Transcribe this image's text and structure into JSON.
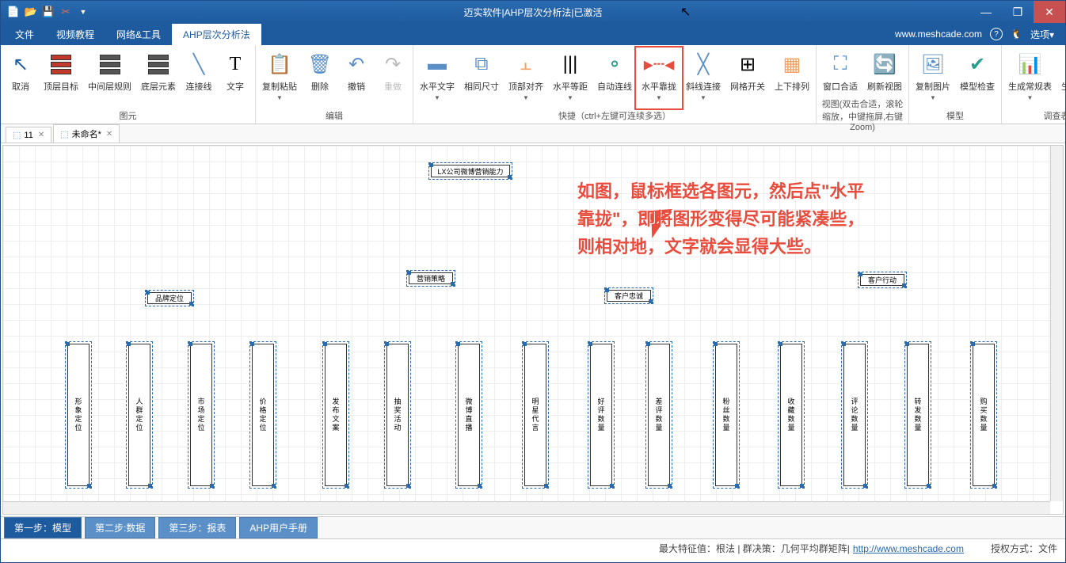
{
  "title": "迈实软件|AHP层次分析法|已激活",
  "website": "www.meshcade.com",
  "options": "选项",
  "menu": {
    "file": "文件",
    "video": "视频教程",
    "net": "网络&工具",
    "ahp": "AHP层次分析法"
  },
  "ribbon": {
    "g1": {
      "label": "图元",
      "cancel": "取消",
      "top": "顶层目标",
      "mid": "中间层规则",
      "bot": "底层元素",
      "conn": "连接线",
      "text": "文字"
    },
    "g2": {
      "label": "编辑",
      "copy": "复制粘贴",
      "del": "删除",
      "undo": "撤销",
      "redo": "重做"
    },
    "g3": {
      "label": "快捷（ctrl+左键可连续多选）",
      "htext": "水平文字",
      "same": "相同尺寸",
      "topalign": "顶部对齐",
      "heq": "水平等距",
      "auto": "自动连线",
      "hclose": "水平靠拢",
      "diag": "斜线连接",
      "grid": "网格开关",
      "vsort": "上下排列"
    },
    "g4": {
      "label": "视图(双击合适，滚轮缩放，中键拖屏,右键Zoom)",
      "fit": "窗口合适",
      "refresh": "刷新视图"
    },
    "g5": {
      "label": "模型",
      "copyimg": "复制图片",
      "check": "模型检查"
    },
    "g6": {
      "label": "调查表",
      "rules": "生成常规表",
      "web": "生成网调表"
    }
  },
  "doctabs": {
    "t1": "11",
    "t2": "未命名*"
  },
  "nodes": {
    "root": "LX公司微博营销能力",
    "l2a": "品牌定位",
    "l2b": "营销策略",
    "l2c": "客户忠诚",
    "l2d": "客户行动",
    "leaves": [
      "形象定位",
      "人群定位",
      "市场定位",
      "价格定位",
      "发布文案",
      "抽奖活动",
      "微博直播",
      "明星代言",
      "好评数量",
      "差评数量",
      "粉丝数量",
      "收藏数量",
      "评论数量",
      "转发数量",
      "购买数量"
    ]
  },
  "annotation": {
    "l1": "如图，鼠标框选各图元，然后点\"水平",
    "l2": "靠拢\"，即将图形变得尽可能紧凑些，",
    "l3": "则相对地，文字就会显得大些。"
  },
  "bottomtabs": {
    "t1": "第一步：模型",
    "t2": "第二步:数据",
    "t3": "第三步：报表",
    "t4": "AHP用户手册"
  },
  "status": {
    "left": "最大特征值：根法 | 群决策：几何平均群矩阵|",
    "url": "http://www.meshcade.com",
    "right": "授权方式：文件"
  }
}
